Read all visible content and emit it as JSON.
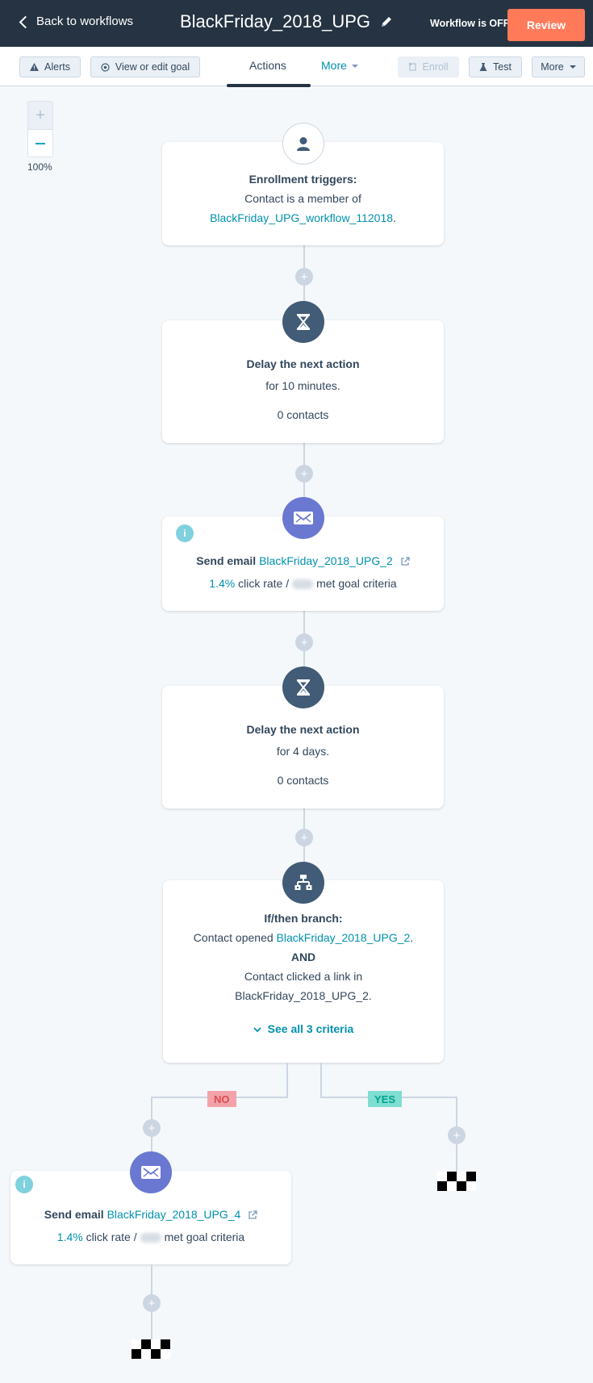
{
  "header": {
    "back_label": "Back to workflows",
    "workflow_name": "BlackFriday_2018_UPG",
    "status": "Workflow is OFF",
    "review_label": "Review"
  },
  "toolbar": {
    "alerts_label": "Alerts",
    "goal_label": "View or edit goal",
    "tabs": [
      {
        "label": "Actions",
        "active": true
      },
      {
        "label": "More",
        "active": false
      }
    ],
    "enroll_label": "Enroll",
    "test_label": "Test",
    "more_label": "More"
  },
  "zoom": {
    "plus": "+",
    "level": "100%"
  },
  "add_action_glyph": "+",
  "nodes": {
    "trigger": {
      "icon": "contact-icon",
      "title": "Enrollment triggers:",
      "text": "Contact is a member of",
      "list_link": "BlackFriday_UPG_workflow_112018",
      "suffix": "."
    },
    "delay1": {
      "icon": "hourglass-icon",
      "title": "Delay the next action",
      "duration": "for 10 minutes.",
      "contacts": "0 contacts"
    },
    "email1": {
      "icon": "email-icon",
      "prefix": "Send email",
      "email_link": "BlackFriday_2018_UPG_2",
      "click_rate": "1.4%",
      "click_rate_label": "click rate /",
      "goal_label": "met goal criteria"
    },
    "delay2": {
      "icon": "hourglass-icon",
      "title": "Delay the next action",
      "duration": "for 4 days.",
      "contacts": "0 contacts"
    },
    "branch": {
      "icon": "branch-icon",
      "title": "If/then branch:",
      "criteria1_prefix": "Contact opened",
      "criteria1_link": "BlackFriday_2018_UPG_2",
      "operator": "AND",
      "criteria2_prefix": "Contact clicked a link in",
      "criteria2_link": "BlackFriday_2018_UPG_2.",
      "see_all": "See all 3 criteria",
      "no_label": "NO",
      "yes_label": "YES"
    },
    "email2": {
      "icon": "email-icon",
      "prefix": "Send email",
      "email_link": "BlackFriday_2018_UPG_4",
      "click_rate": "1.4%",
      "click_rate_label": "click rate /",
      "goal_label": "met goal criteria"
    }
  },
  "colors": {
    "header_bg": "#253342",
    "review": "#ff7a59",
    "link": "#0091ae",
    "email_node": "#6a78d1",
    "delay_node": "#425b76",
    "no_badge": "#f2a3a9",
    "yes_badge": "#7fded1"
  }
}
